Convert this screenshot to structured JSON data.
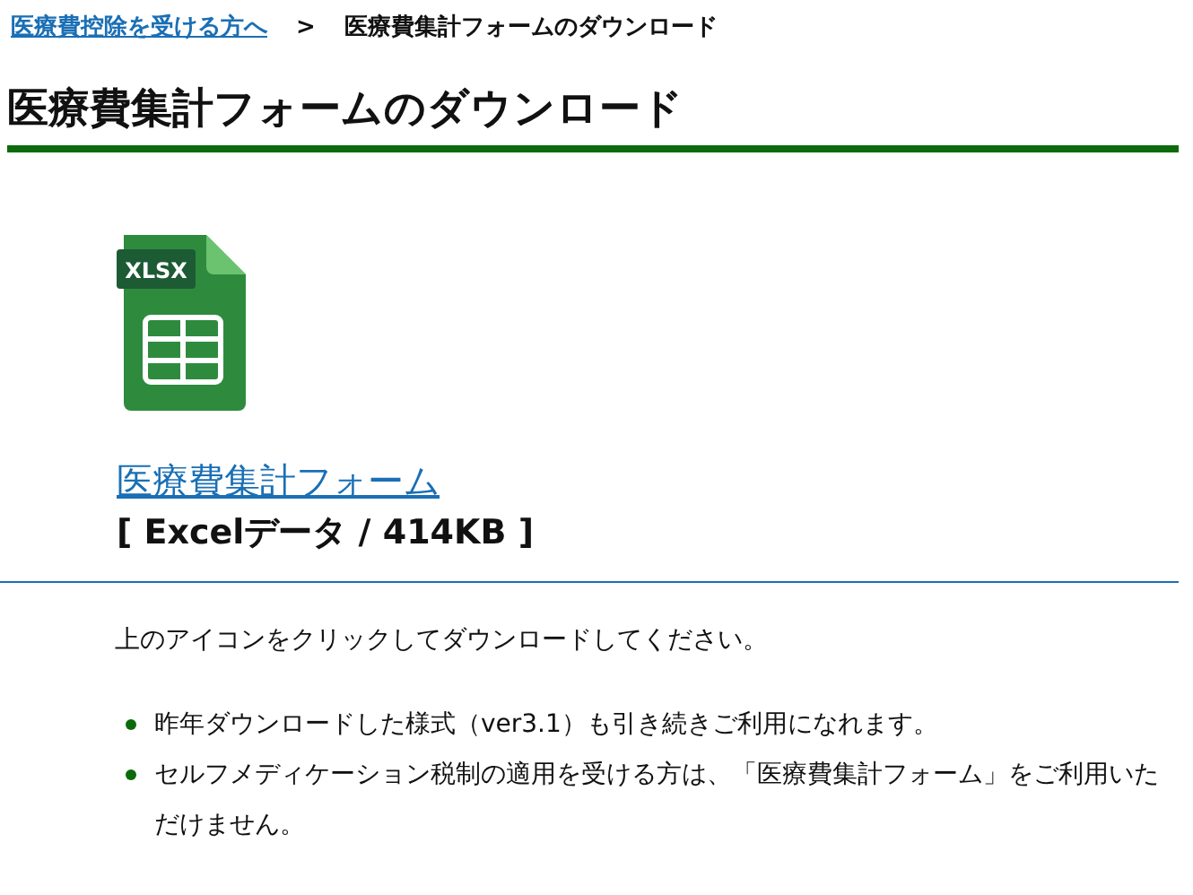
{
  "breadcrumb": [
    {
      "label": "医療費控除を受ける方へ",
      "kind": "link"
    },
    {
      "label": ">",
      "kind": "separator"
    },
    {
      "label": "医療費集計フォームのダウンロード",
      "kind": "current"
    }
  ],
  "title": "医療費集計フォームのダウンロード",
  "download": {
    "icon_label": "XLSX",
    "link": "医療費集計フォーム",
    "file_info": "[ Excelデータ / 414KB ]"
  },
  "instruction": "上のアイコンをクリックしてダウンロードしてください。",
  "notes": [
    "昨年ダウンロードした様式（ver3.1）も引き続きご利用になれます。",
    "セルフメディケーション税制の適用を受ける方は、「医療費集計フォーム」をご利用いただけません。"
  ]
}
